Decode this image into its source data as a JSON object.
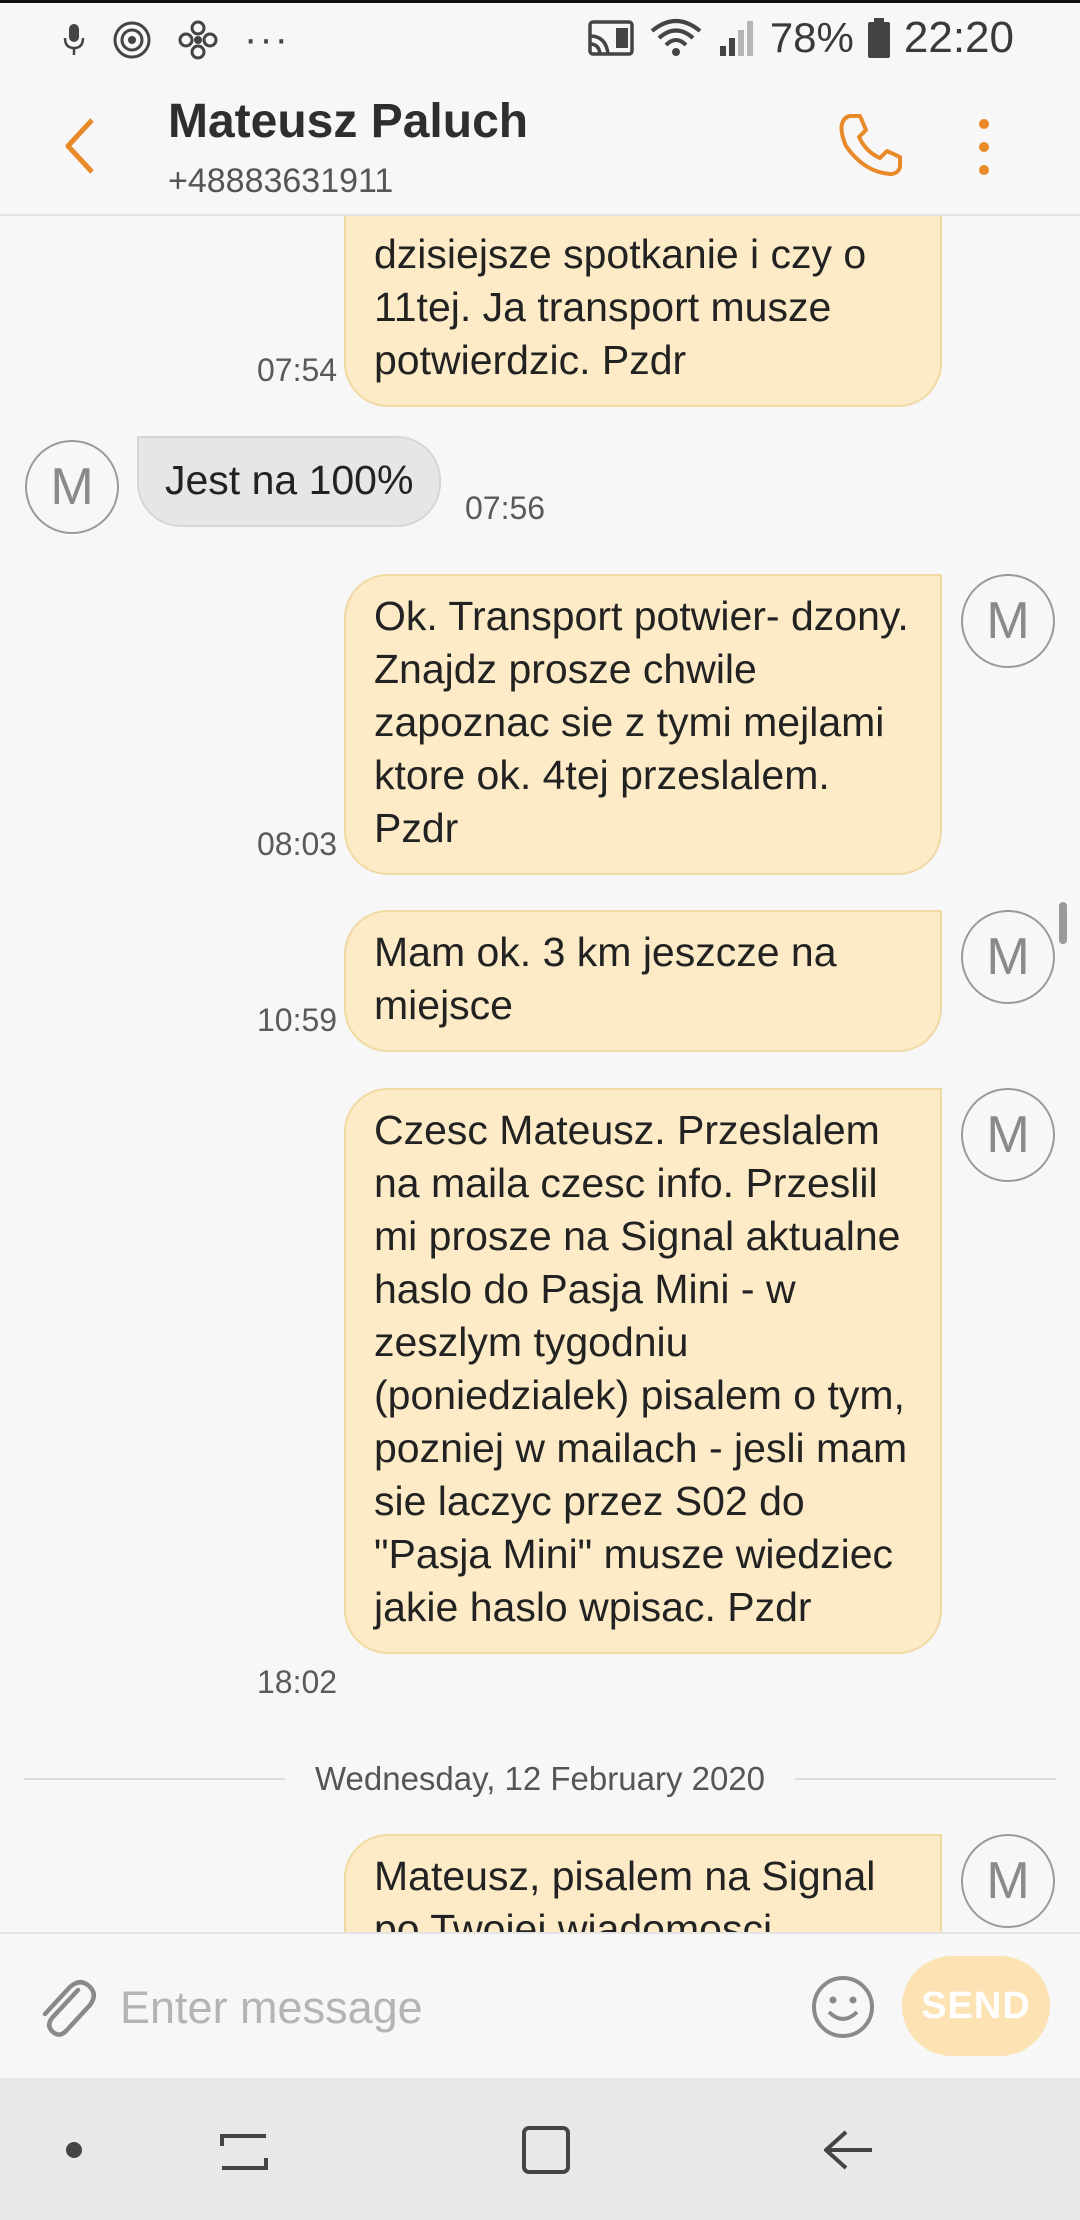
{
  "status_bar": {
    "battery": "78%",
    "time": "22:20",
    "overflow": "···"
  },
  "header": {
    "contact_name": "Mateusz Paluch",
    "contact_number": "+48883631911"
  },
  "messages": [
    {
      "direction": "outgoing",
      "text": "dzisiejsze spotkanie i czy o 11tej. Ja transport musze potwierdzic. Pzdr",
      "time": "07:54"
    },
    {
      "direction": "incoming",
      "text": "Jest na 100%",
      "time": "07:56",
      "avatar": "M"
    },
    {
      "direction": "outgoing",
      "text": "Ok. Transport potwier- dzony. Znajdz prosze chwile zapoznac sie z tymi mejlami ktore ok. 4tej przeslalem. Pzdr",
      "time": "08:03",
      "avatar": "M"
    },
    {
      "direction": "outgoing",
      "text": "Mam ok. 3 km jeszcze na miejsce",
      "time": "10:59",
      "avatar": "M"
    },
    {
      "direction": "outgoing",
      "text": "Czesc Mateusz. Przeslalem na maila czesc info. Przeslil mi prosze na Signal aktualne haslo do Pasja Mini - w zeszlym tygodniu (poniedzialek) pisalem o tym, pozniej w mailach - jesli mam sie laczyc przez S02 do \"Pasja Mini\" musze wiedziec jakie haslo wpisac. Pzdr",
      "time": "18:02",
      "avatar": "M"
    },
    {
      "direction": "outgoing",
      "text": "Mateusz, pisalem na Signal po Twojej wiadomosci",
      "avatar": "M"
    }
  ],
  "date_separator": "Wednesday, 12 February 2020",
  "compose": {
    "placeholder": "Enter message",
    "send_label": "SEND"
  },
  "colors": {
    "accent": "#e8892a",
    "outgoing_bubble": "#fcebc6",
    "incoming_bubble": "#e6e6e6",
    "send_button": "#fde2b4"
  },
  "icons": {
    "status_left": [
      "microphone-icon",
      "hotspot-icon",
      "fan-icon",
      "more-notifications-icon"
    ],
    "status_right": [
      "cast-icon",
      "wifi-icon",
      "signal-icon",
      "battery-icon"
    ],
    "header": [
      "back-arrow-icon",
      "phone-icon",
      "more-vertical-icon"
    ],
    "compose": [
      "paperclip-icon",
      "emoji-icon"
    ],
    "navbar": [
      "dot-icon",
      "recent-apps-icon",
      "home-icon",
      "back-icon"
    ]
  }
}
